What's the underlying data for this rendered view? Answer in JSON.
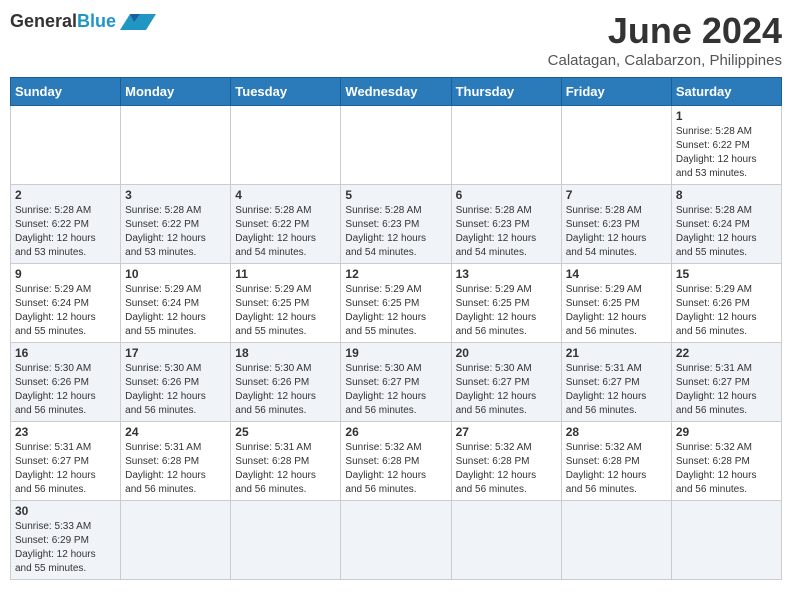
{
  "header": {
    "logo_general": "General",
    "logo_blue": "Blue",
    "month_title": "June 2024",
    "subtitle": "Calatagan, Calabarzon, Philippines"
  },
  "days_of_week": [
    "Sunday",
    "Monday",
    "Tuesday",
    "Wednesday",
    "Thursday",
    "Friday",
    "Saturday"
  ],
  "weeks": [
    [
      {
        "day": "",
        "info": ""
      },
      {
        "day": "",
        "info": ""
      },
      {
        "day": "",
        "info": ""
      },
      {
        "day": "",
        "info": ""
      },
      {
        "day": "",
        "info": ""
      },
      {
        "day": "",
        "info": ""
      },
      {
        "day": "1",
        "info": "Sunrise: 5:28 AM\nSunset: 6:22 PM\nDaylight: 12 hours\nand 53 minutes."
      }
    ],
    [
      {
        "day": "2",
        "info": "Sunrise: 5:28 AM\nSunset: 6:22 PM\nDaylight: 12 hours\nand 53 minutes."
      },
      {
        "day": "3",
        "info": "Sunrise: 5:28 AM\nSunset: 6:22 PM\nDaylight: 12 hours\nand 53 minutes."
      },
      {
        "day": "4",
        "info": "Sunrise: 5:28 AM\nSunset: 6:22 PM\nDaylight: 12 hours\nand 54 minutes."
      },
      {
        "day": "5",
        "info": "Sunrise: 5:28 AM\nSunset: 6:23 PM\nDaylight: 12 hours\nand 54 minutes."
      },
      {
        "day": "6",
        "info": "Sunrise: 5:28 AM\nSunset: 6:23 PM\nDaylight: 12 hours\nand 54 minutes."
      },
      {
        "day": "7",
        "info": "Sunrise: 5:28 AM\nSunset: 6:23 PM\nDaylight: 12 hours\nand 54 minutes."
      },
      {
        "day": "8",
        "info": "Sunrise: 5:28 AM\nSunset: 6:24 PM\nDaylight: 12 hours\nand 55 minutes."
      }
    ],
    [
      {
        "day": "9",
        "info": "Sunrise: 5:29 AM\nSunset: 6:24 PM\nDaylight: 12 hours\nand 55 minutes."
      },
      {
        "day": "10",
        "info": "Sunrise: 5:29 AM\nSunset: 6:24 PM\nDaylight: 12 hours\nand 55 minutes."
      },
      {
        "day": "11",
        "info": "Sunrise: 5:29 AM\nSunset: 6:25 PM\nDaylight: 12 hours\nand 55 minutes."
      },
      {
        "day": "12",
        "info": "Sunrise: 5:29 AM\nSunset: 6:25 PM\nDaylight: 12 hours\nand 55 minutes."
      },
      {
        "day": "13",
        "info": "Sunrise: 5:29 AM\nSunset: 6:25 PM\nDaylight: 12 hours\nand 56 minutes."
      },
      {
        "day": "14",
        "info": "Sunrise: 5:29 AM\nSunset: 6:25 PM\nDaylight: 12 hours\nand 56 minutes."
      },
      {
        "day": "15",
        "info": "Sunrise: 5:29 AM\nSunset: 6:26 PM\nDaylight: 12 hours\nand 56 minutes."
      }
    ],
    [
      {
        "day": "16",
        "info": "Sunrise: 5:30 AM\nSunset: 6:26 PM\nDaylight: 12 hours\nand 56 minutes."
      },
      {
        "day": "17",
        "info": "Sunrise: 5:30 AM\nSunset: 6:26 PM\nDaylight: 12 hours\nand 56 minutes."
      },
      {
        "day": "18",
        "info": "Sunrise: 5:30 AM\nSunset: 6:26 PM\nDaylight: 12 hours\nand 56 minutes."
      },
      {
        "day": "19",
        "info": "Sunrise: 5:30 AM\nSunset: 6:27 PM\nDaylight: 12 hours\nand 56 minutes."
      },
      {
        "day": "20",
        "info": "Sunrise: 5:30 AM\nSunset: 6:27 PM\nDaylight: 12 hours\nand 56 minutes."
      },
      {
        "day": "21",
        "info": "Sunrise: 5:31 AM\nSunset: 6:27 PM\nDaylight: 12 hours\nand 56 minutes."
      },
      {
        "day": "22",
        "info": "Sunrise: 5:31 AM\nSunset: 6:27 PM\nDaylight: 12 hours\nand 56 minutes."
      }
    ],
    [
      {
        "day": "23",
        "info": "Sunrise: 5:31 AM\nSunset: 6:27 PM\nDaylight: 12 hours\nand 56 minutes."
      },
      {
        "day": "24",
        "info": "Sunrise: 5:31 AM\nSunset: 6:28 PM\nDaylight: 12 hours\nand 56 minutes."
      },
      {
        "day": "25",
        "info": "Sunrise: 5:31 AM\nSunset: 6:28 PM\nDaylight: 12 hours\nand 56 minutes."
      },
      {
        "day": "26",
        "info": "Sunrise: 5:32 AM\nSunset: 6:28 PM\nDaylight: 12 hours\nand 56 minutes."
      },
      {
        "day": "27",
        "info": "Sunrise: 5:32 AM\nSunset: 6:28 PM\nDaylight: 12 hours\nand 56 minutes."
      },
      {
        "day": "28",
        "info": "Sunrise: 5:32 AM\nSunset: 6:28 PM\nDaylight: 12 hours\nand 56 minutes."
      },
      {
        "day": "29",
        "info": "Sunrise: 5:32 AM\nSunset: 6:28 PM\nDaylight: 12 hours\nand 56 minutes."
      }
    ],
    [
      {
        "day": "30",
        "info": "Sunrise: 5:33 AM\nSunset: 6:29 PM\nDaylight: 12 hours\nand 55 minutes."
      },
      {
        "day": "",
        "info": ""
      },
      {
        "day": "",
        "info": ""
      },
      {
        "day": "",
        "info": ""
      },
      {
        "day": "",
        "info": ""
      },
      {
        "day": "",
        "info": ""
      },
      {
        "day": "",
        "info": ""
      }
    ]
  ]
}
